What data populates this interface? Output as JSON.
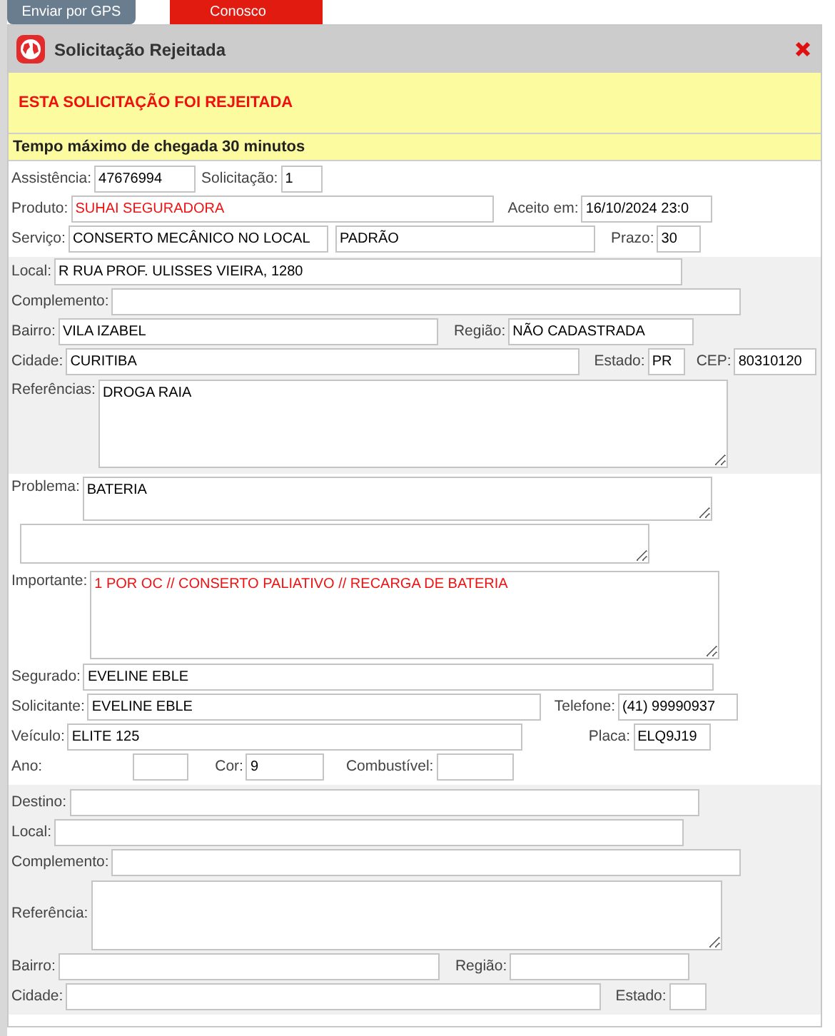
{
  "top_buttons": [
    {
      "label": "Enviar por GPS",
      "kind": "gps"
    },
    {
      "label": "Conosco",
      "kind": "contact"
    }
  ],
  "dialog": {
    "title": "Solicitação Rejeitada",
    "alert": "ESTA SOLICITAÇÃO FOI REJEITADA",
    "notice": "Tempo máximo de chegada 30 minutos"
  },
  "request": {
    "assistencia": {
      "label": "Assistência:",
      "value": "47676994"
    },
    "solicitacao": {
      "label": "Solicitação:",
      "value": "1"
    },
    "produto": {
      "label": "Produto:",
      "value": "SUHAI SEGURADORA"
    },
    "aceito_em": {
      "label": "Aceito em:",
      "value": "16/10/2024 23:0"
    },
    "servico": {
      "label": "Serviço:",
      "value": "CONSERTO MECÂNICO NO LOCAL"
    },
    "servico_tipo": {
      "value": "PADRÃO"
    },
    "prazo": {
      "label": "Prazo:",
      "value": "30"
    }
  },
  "origin": {
    "local": {
      "label": "Local:",
      "value": "R RUA PROF. ULISSES VIEIRA, 1280"
    },
    "complemento": {
      "label": "Complemento:"
    },
    "bairro": {
      "label": "Bairro:",
      "value": "VILA IZABEL"
    },
    "regiao": {
      "label": "Região:",
      "value": "NÃO CADASTRADA"
    },
    "cidade": {
      "label": "Cidade:",
      "value": "CURITIBA"
    },
    "estado": {
      "label": "Estado:",
      "value": "PR"
    },
    "cep": {
      "label": "CEP:",
      "value": "80310120"
    },
    "referencias": {
      "label": "Referências:",
      "value": "DROGA RAIA"
    }
  },
  "details": {
    "problema": {
      "label": "Problema:",
      "value": "BATERIA"
    },
    "importante": {
      "label": "Importante:",
      "value": "1 POR OC // CONSERTO PALIATIVO // RECARGA DE BATERIA"
    },
    "segurado": {
      "label": "Segurado:",
      "value": "EVELINE EBLE"
    },
    "solicitante": {
      "label": "Solicitante:",
      "value": "EVELINE EBLE"
    },
    "telefone": {
      "label": "Telefone:",
      "value": "(41) 99990937"
    },
    "veiculo": {
      "label": "Veículo:",
      "value": "ELITE 125"
    },
    "placa": {
      "label": "Placa:",
      "value": "ELQ9J19"
    },
    "ano": {
      "label": "Ano:"
    },
    "cor": {
      "label": "Cor:",
      "value": "9"
    },
    "combustivel": {
      "label": "Combustível:"
    }
  },
  "destination": {
    "destino": {
      "label": "Destino:"
    },
    "local": {
      "label": "Local:"
    },
    "complemento": {
      "label": "Complemento:"
    },
    "referencia": {
      "label": "Referência:"
    },
    "bairro": {
      "label": "Bairro:"
    },
    "regiao": {
      "label": "Região:"
    },
    "cidade": {
      "label": "Cidade:"
    },
    "estado": {
      "label": "Estado:"
    }
  }
}
